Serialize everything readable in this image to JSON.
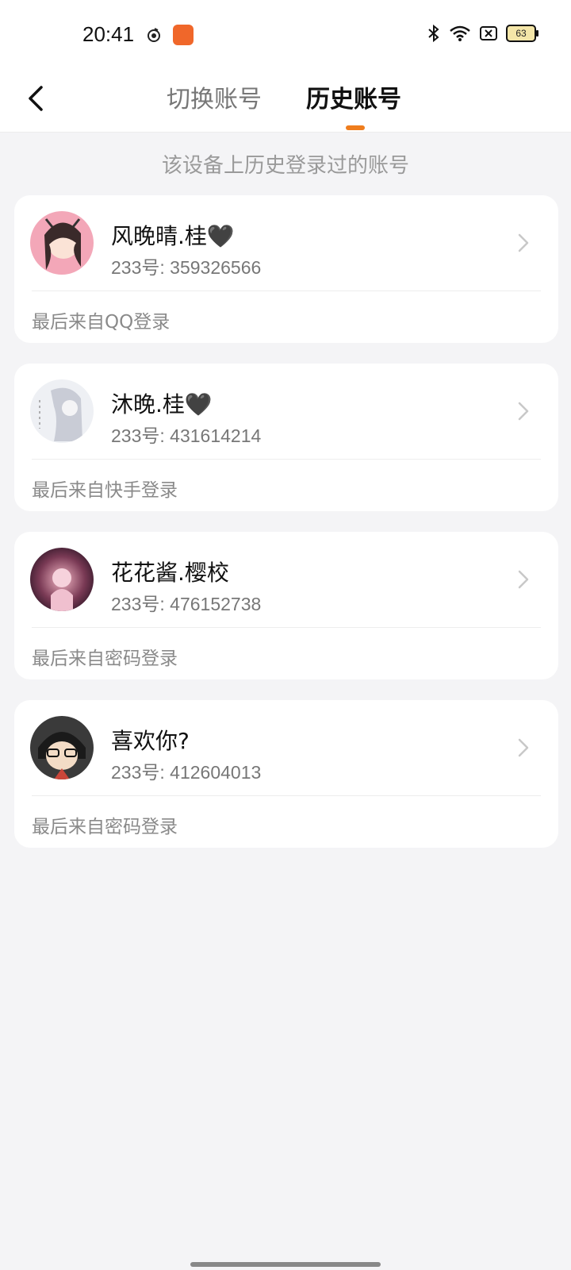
{
  "status_bar": {
    "time": "20:41",
    "battery": "63",
    "icons": [
      "app-notification-icon",
      "app-badge-icon",
      "bluetooth-icon",
      "wifi-icon",
      "sim-off-icon",
      "battery-icon"
    ]
  },
  "header": {
    "back_icon": "back-arrow-icon",
    "tabs": [
      {
        "label": "切换账号",
        "active": false
      },
      {
        "label": "历史账号",
        "active": true
      }
    ],
    "accent_color": "#ef7d1d"
  },
  "subtitle": "该设备上历史登录过的账号",
  "accounts": [
    {
      "name": "风晚晴.桂🖤",
      "id_label": "233号: 359326566",
      "source": "最后来自QQ登录"
    },
    {
      "name": "沐晚.桂🖤",
      "id_label": "233号: 431614214",
      "source": "最后来自快手登录"
    },
    {
      "name": "花花酱.樱校",
      "id_label": "233号: 476152738",
      "source": "最后来自密码登录"
    },
    {
      "name": "喜欢你?",
      "id_label": "233号: 412604013",
      "source": "最后来自密码登录"
    }
  ]
}
